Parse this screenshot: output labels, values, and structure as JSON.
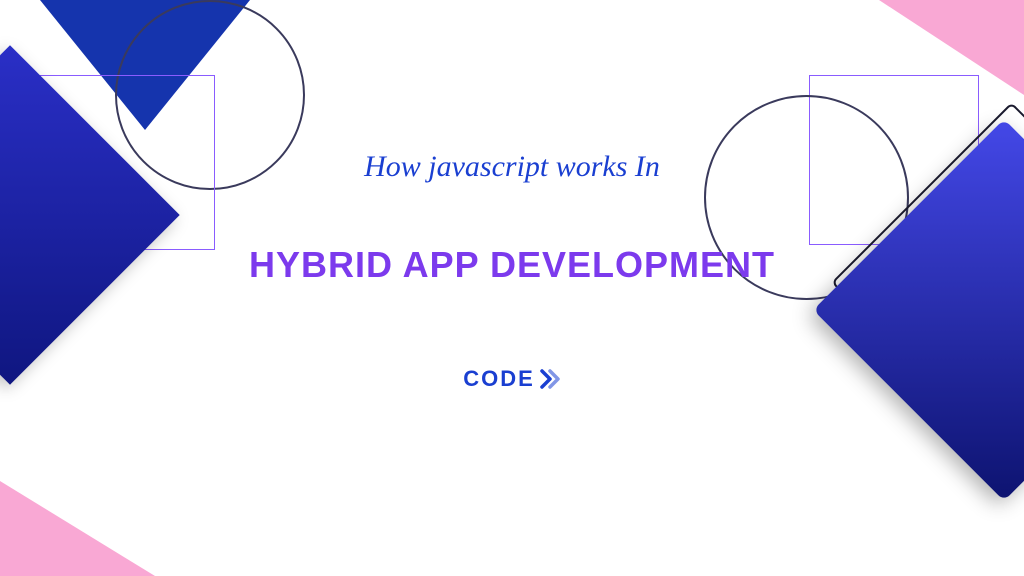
{
  "subtitle": "How javascript works In",
  "title": "HYBRID APP DEVELOPMENT",
  "logo": {
    "text": "CODE"
  },
  "colors": {
    "primary_blue": "#1a3fd1",
    "accent_purple": "#7c3aed",
    "pink": "#f9a8d4",
    "gradient_start": "#4448e8",
    "gradient_end": "#0d1370"
  }
}
